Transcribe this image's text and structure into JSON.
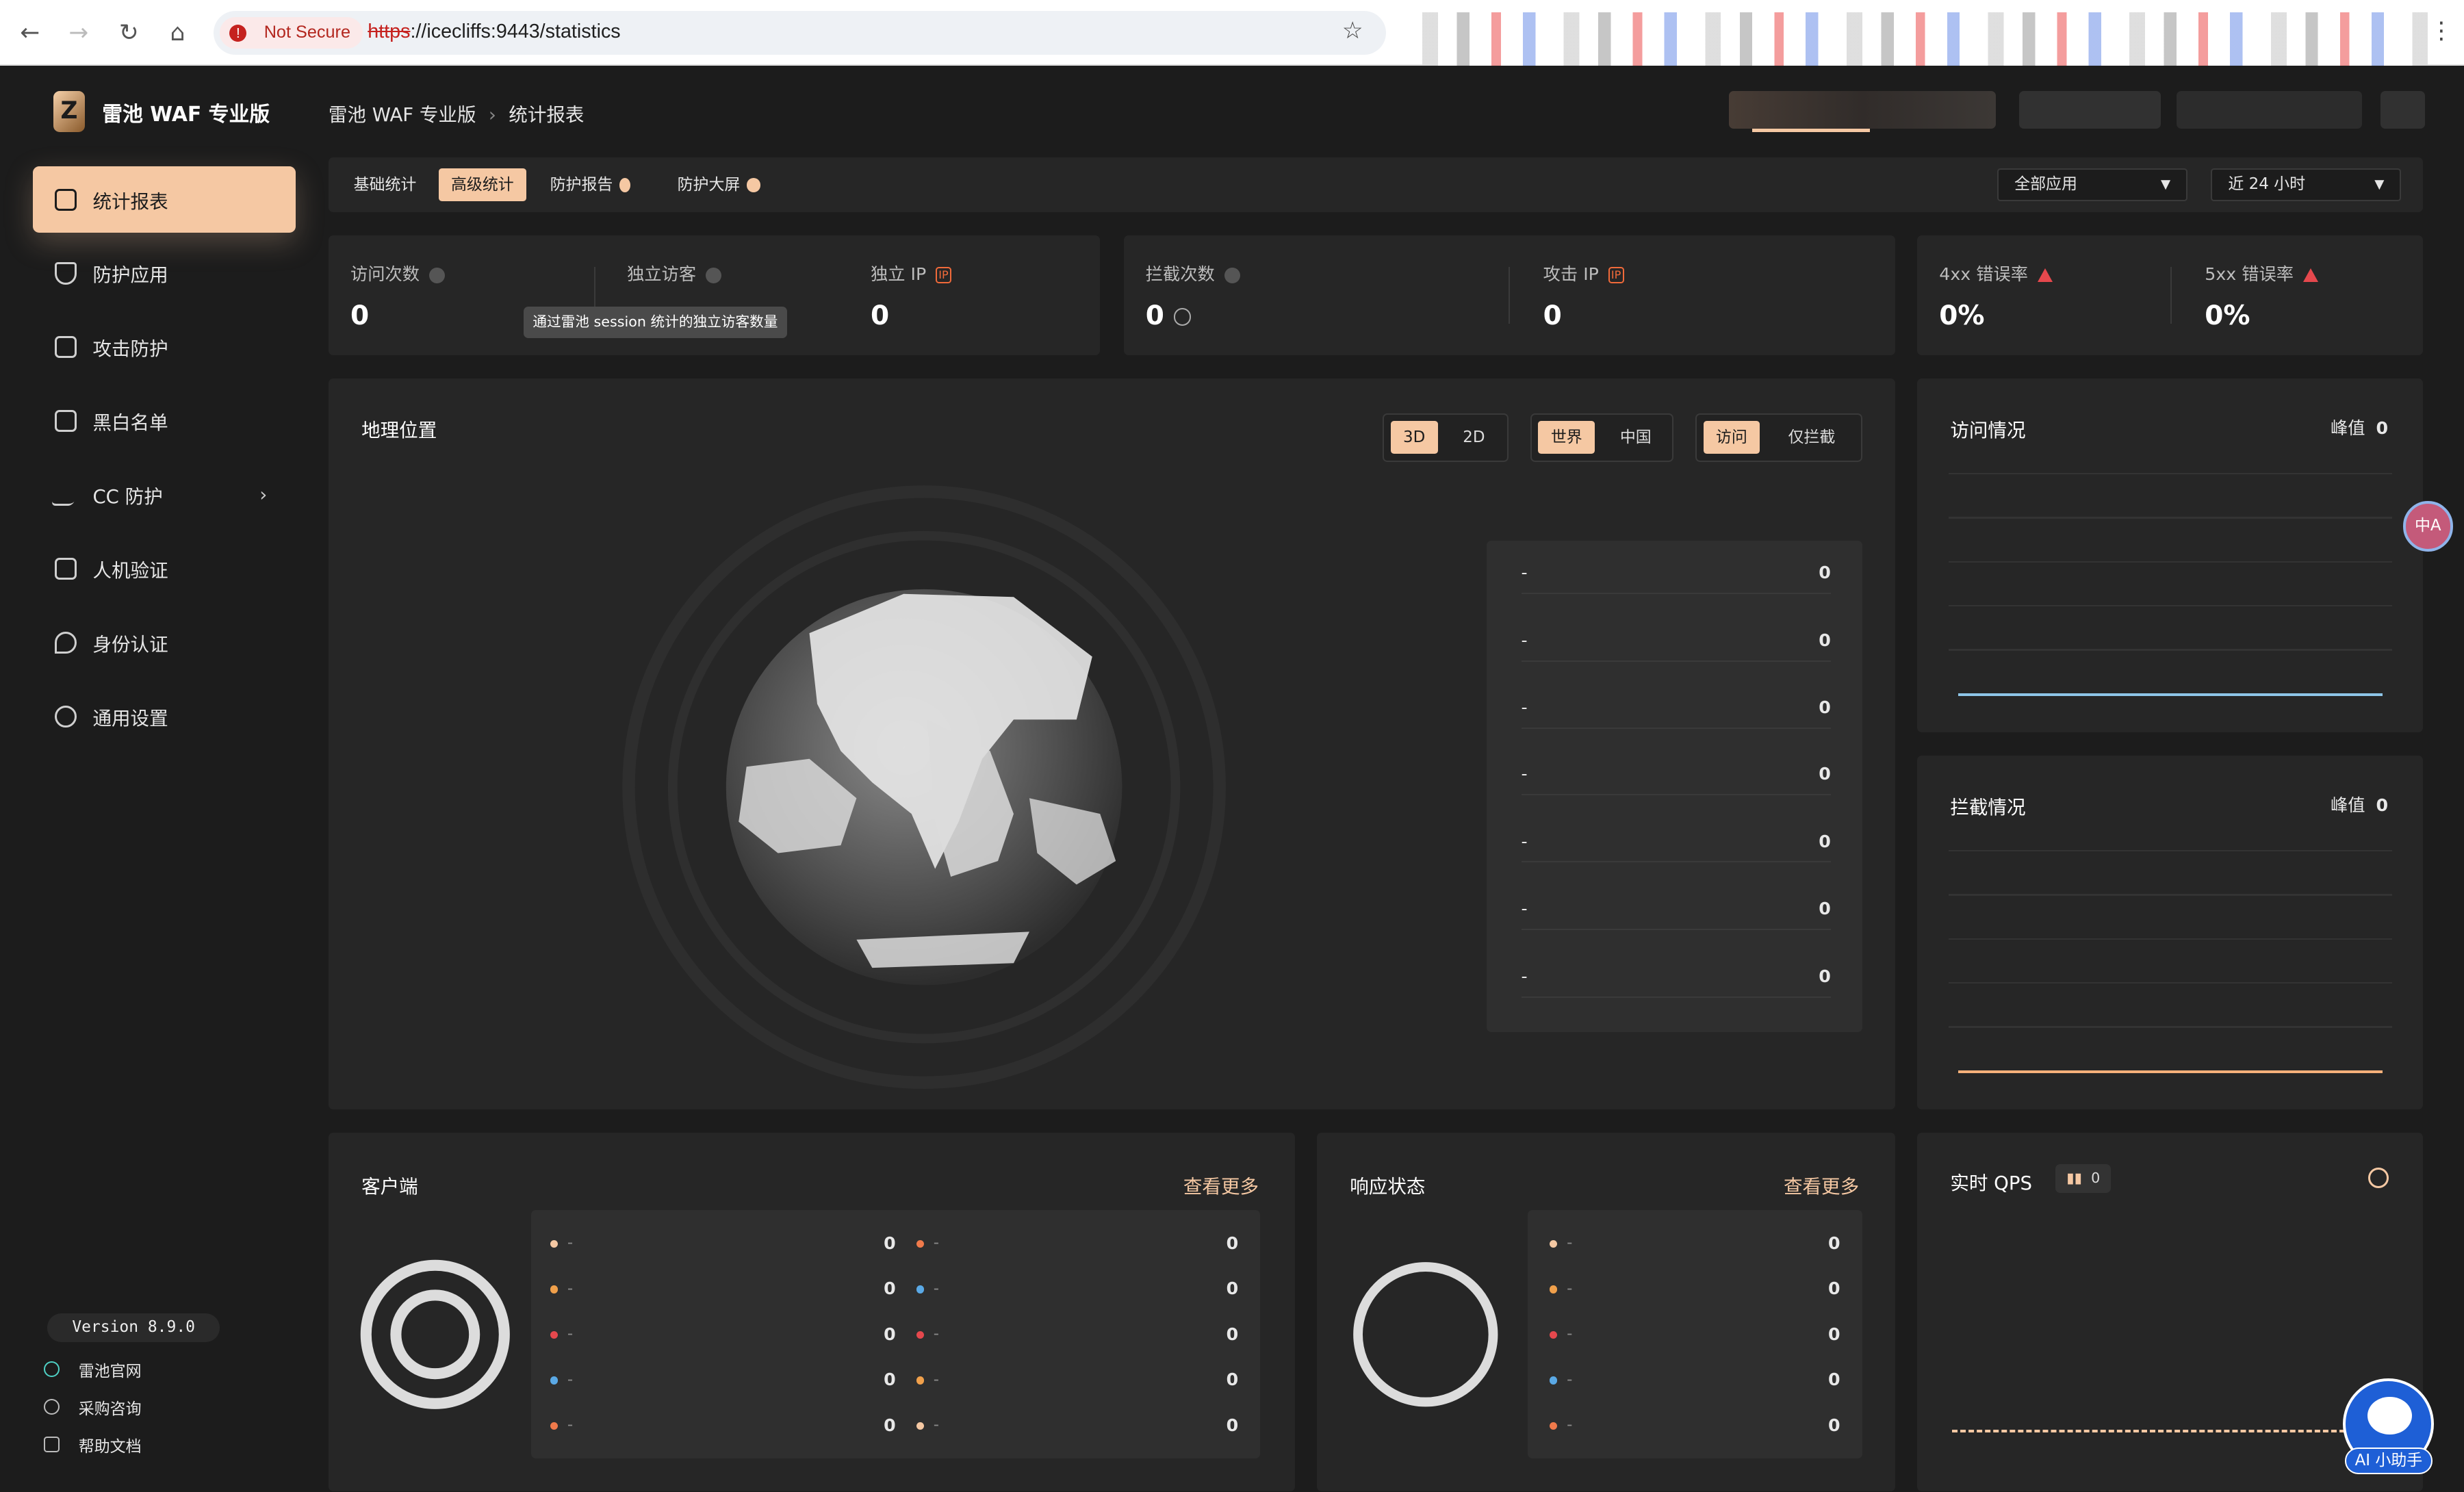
{
  "browser": {
    "security_label": "Not Secure",
    "url_scheme": "https",
    "url_rest": "://icecliffs:9443/statistics"
  },
  "app": {
    "brand": "雷池 WAF 专业版"
  },
  "breadcrumb": {
    "root": "雷池 WAF 专业版",
    "current": "统计报表"
  },
  "sidebar": {
    "items": [
      {
        "label": "统计报表",
        "icon": "bar-chart-icon",
        "active": true
      },
      {
        "label": "防护应用",
        "icon": "shield-icon"
      },
      {
        "label": "攻击防护",
        "icon": "document-icon"
      },
      {
        "label": "黑白名单",
        "icon": "list-icon"
      },
      {
        "label": "CC 防护",
        "icon": "pulse-icon",
        "has_children": true
      },
      {
        "label": "人机验证",
        "icon": "robot-icon"
      },
      {
        "label": "身份认证",
        "icon": "key-icon"
      },
      {
        "label": "通用设置",
        "icon": "gear-icon"
      }
    ],
    "version": "Version 8.9.0",
    "footer_links": [
      "雷池官网",
      "采购咨询",
      "帮助文档"
    ]
  },
  "tabs": {
    "items": [
      "基础统计",
      "高级统计",
      "防护报告",
      "防护大屏"
    ],
    "active_index": 1
  },
  "filters": {
    "app_select": "全部应用",
    "time_select": "近 24 小时"
  },
  "stats": {
    "visits": {
      "label": "访问次数",
      "value": "0"
    },
    "unique_visitors": {
      "label": "独立访客",
      "value": "0",
      "tooltip": "通过雷池 session 统计的独立访客数量"
    },
    "unique_ip": {
      "label": "独立 IP",
      "value": "0"
    },
    "blocks": {
      "label": "拦截次数",
      "value": "0"
    },
    "attack_ip": {
      "label": "攻击 IP",
      "value": "0"
    },
    "err4xx": {
      "label": "4xx 错误率",
      "value": "0%"
    },
    "err5xx": {
      "label": "5xx 错误率",
      "value": "0%"
    }
  },
  "geo": {
    "title": "地理位置",
    "view": [
      "3D",
      "2D"
    ],
    "region": [
      "世界",
      "中国"
    ],
    "mode": [
      "访问",
      "仅拦截"
    ],
    "rows": [
      {
        "name": "-",
        "value": "0"
      },
      {
        "name": "-",
        "value": "0"
      },
      {
        "name": "-",
        "value": "0"
      },
      {
        "name": "-",
        "value": "0"
      },
      {
        "name": "-",
        "value": "0"
      },
      {
        "name": "-",
        "value": "0"
      },
      {
        "name": "-",
        "value": "0"
      }
    ]
  },
  "access": {
    "title": "访问情况",
    "peak_label": "峰值",
    "peak_value": "0"
  },
  "intercept": {
    "title": "拦截情况",
    "peak_label": "峰值",
    "peak_value": "0"
  },
  "client": {
    "title": "客户端",
    "more": "查看更多",
    "left": [
      {
        "name": "-",
        "value": "0",
        "color": "#f5c8a3"
      },
      {
        "name": "-",
        "value": "0",
        "color": "#f0a04b"
      },
      {
        "name": "-",
        "value": "0",
        "color": "#e5484d"
      },
      {
        "name": "-",
        "value": "0",
        "color": "#5aa9e6"
      },
      {
        "name": "-",
        "value": "0",
        "color": "#f07a4b"
      }
    ],
    "right": [
      {
        "name": "-",
        "value": "0",
        "color": "#f07a4b"
      },
      {
        "name": "-",
        "value": "0",
        "color": "#5aa9e6"
      },
      {
        "name": "-",
        "value": "0",
        "color": "#e5484d"
      },
      {
        "name": "-",
        "value": "0",
        "color": "#f0a04b"
      },
      {
        "name": "-",
        "value": "0",
        "color": "#f5c8a3"
      }
    ]
  },
  "response": {
    "title": "响应状态",
    "more": "查看更多",
    "rows": [
      {
        "name": "-",
        "value": "0",
        "color": "#f5c8a3"
      },
      {
        "name": "-",
        "value": "0",
        "color": "#f0a04b"
      },
      {
        "name": "-",
        "value": "0",
        "color": "#e5484d"
      },
      {
        "name": "-",
        "value": "0",
        "color": "#5aa9e6"
      },
      {
        "name": "-",
        "value": "0",
        "color": "#f07a4b"
      }
    ]
  },
  "qps": {
    "title": "实时 QPS",
    "value": "0"
  },
  "assistant": {
    "label": "AI 小助手"
  },
  "colors": {
    "accent": "#f5c8a3",
    "line_blue": "#8ec5e8",
    "line_orange": "#f5b07a"
  }
}
